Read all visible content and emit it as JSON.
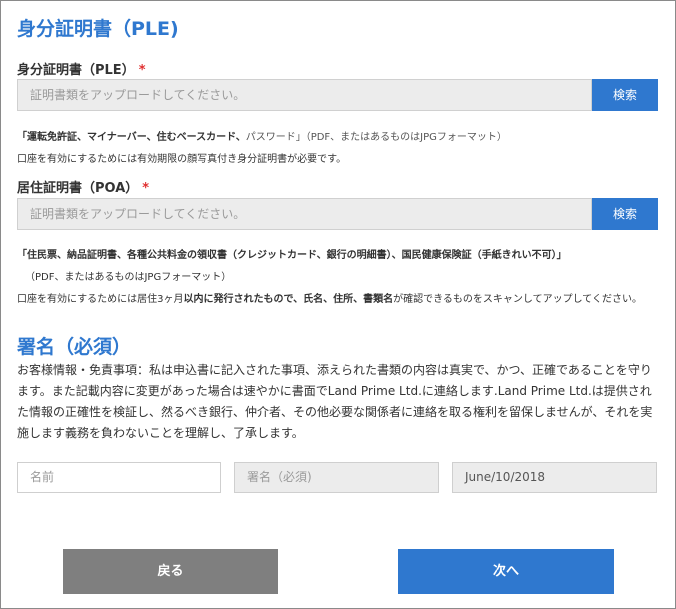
{
  "ple_section": {
    "title": "身分証明書（PLE)",
    "field_label": "身分証明書（PLE）",
    "required_mark": "*",
    "upload_placeholder": "証明書類をアップロードしてください。",
    "search_label": "検索",
    "note_bold": "「運転免許証、マイナーバー、住むベースカード、",
    "note_rest": "パスワード」（PDF、またはあるものはJPGフォーマット）",
    "requirement": "口座を有効にするためには有効期限の顔写真付き身分証明書が必要です。"
  },
  "poa_section": {
    "field_label": "居住証明書（POA）",
    "required_mark": "*",
    "upload_placeholder": "証明書類をアップロードしてください。",
    "search_label": "検索",
    "note_bold": "「住民票、納品証明書、各種公共料金の領収書（クレジットカード、銀行の明細書）、国民健康保険証（手紙きれい不可）」",
    "format_note": "（PDF、またはあるものはJPGフォーマット）",
    "req_part1": "口座を有効にするためには居住3ヶ月",
    "req_bold1": "以内に発行されたもので、氏名、住所、書類名",
    "req_part2": "が確認できるものをスキャンしてアップしてください。"
  },
  "signature_section": {
    "title": "署名（必須）",
    "disclaimer": "お客様情報・免責事項：私は申込書に記入された事項、添えられた書類の内容は真実で、かつ、正確であることを守ります。また記載内容に変更があった場合は速やかに書面でLand Prime Ltd.に連絡します.Land Prime Ltd.は提供された情報の正確性を検証し、然るべき銀行、仲介者、その他必要な関係者に連絡を取る権利を留保しませんが、それを実施します義務を負わないことを理解し、了承します。",
    "name_placeholder": "名前",
    "signature_placeholder": "署名（必須)",
    "date_value": "June/10/2018"
  },
  "footer": {
    "back_label": "戻る",
    "next_label": "次へ"
  },
  "colors": {
    "accent": "#2f78cf",
    "required": "#e03030",
    "back_button": "#7f7f7f"
  }
}
